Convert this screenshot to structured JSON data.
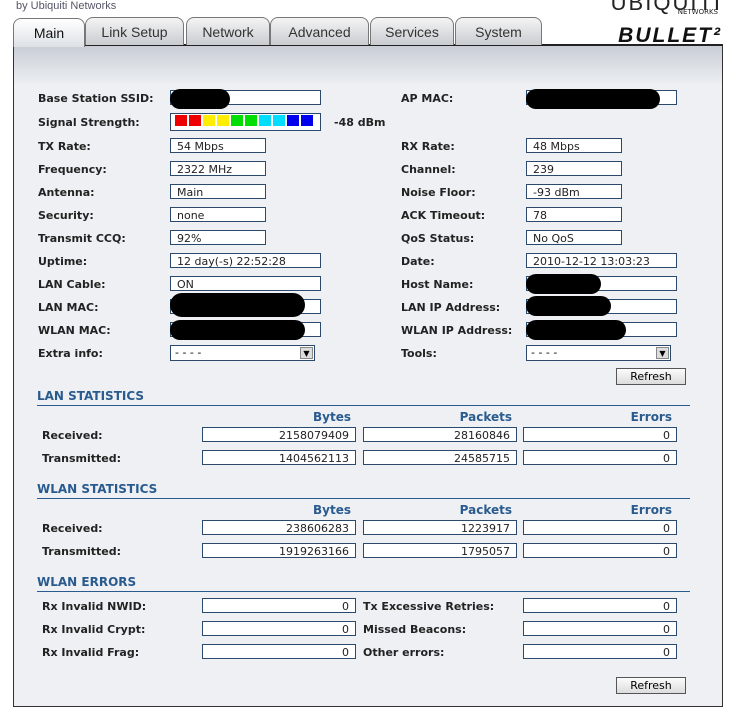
{
  "header": {
    "brand_sub": "by Ubiquiti Networks",
    "logo": "UBIQUITI",
    "logo_sub": "NETWORKS",
    "product": "BULLET²"
  },
  "tabs": [
    "Main",
    "Link Setup",
    "Network",
    "Advanced",
    "Services",
    "System"
  ],
  "left": {
    "ssid_label": "Base Station SSID:",
    "signal_label": "Signal Strength:",
    "signal_value": "-48 dBm",
    "signal_colors": [
      "#ee0000",
      "#ee0000",
      "#ffee00",
      "#ffee00",
      "#00dd00",
      "#00dd00",
      "#00ddff",
      "#00ddff",
      "#0000ee",
      "#0000ee"
    ],
    "rows": [
      {
        "label": "TX Rate:",
        "value": "54 Mbps"
      },
      {
        "label": "Frequency:",
        "value": "2322 MHz"
      },
      {
        "label": "Antenna:",
        "value": "Main"
      },
      {
        "label": "Security:",
        "value": "none"
      },
      {
        "label": "Transmit CCQ:",
        "value": "92%"
      },
      {
        "label": "Uptime:",
        "value": "12 day(-s) 22:52:28"
      },
      {
        "label": "LAN Cable:",
        "value": "ON"
      }
    ],
    "lan_mac_label": "LAN MAC:",
    "wlan_mac_label": "WLAN MAC:",
    "extra_label": "Extra info:",
    "extra_value": "- - - -"
  },
  "right": {
    "ap_mac_label": "AP MAC:",
    "rows": [
      {
        "label": "RX Rate:",
        "value": "48 Mbps"
      },
      {
        "label": "Channel:",
        "value": "239"
      },
      {
        "label": "Noise Floor:",
        "value": "-93 dBm"
      },
      {
        "label": "ACK Timeout:",
        "value": "78"
      },
      {
        "label": "QoS Status:",
        "value": "No QoS"
      },
      {
        "label": "Date:",
        "value": "2010-12-12 13:03:23"
      }
    ],
    "host_label": "Host Name:",
    "lan_ip_label": "LAN IP Address:",
    "wlan_ip_label": "WLAN IP Address:",
    "tools_label": "Tools:",
    "tools_value": "- - - -"
  },
  "refresh": "Refresh",
  "lan_stats": {
    "title": "LAN STATISTICS",
    "cols": [
      "Bytes",
      "Packets",
      "Errors"
    ],
    "rows": [
      {
        "label": "Received:",
        "bytes": "2158079409",
        "packets": "28160846",
        "errors": "0"
      },
      {
        "label": "Transmitted:",
        "bytes": "1404562113",
        "packets": "24585715",
        "errors": "0"
      }
    ]
  },
  "wlan_stats": {
    "title": "WLAN STATISTICS",
    "cols": [
      "Bytes",
      "Packets",
      "Errors"
    ],
    "rows": [
      {
        "label": "Received:",
        "bytes": "238606283",
        "packets": "1223917",
        "errors": "0"
      },
      {
        "label": "Transmitted:",
        "bytes": "1919263166",
        "packets": "1795057",
        "errors": "0"
      }
    ]
  },
  "wlan_errors": {
    "title": "WLAN ERRORS",
    "left": [
      {
        "label": "Rx Invalid NWID:",
        "value": "0"
      },
      {
        "label": "Rx Invalid Crypt:",
        "value": "0"
      },
      {
        "label": "Rx Invalid Frag:",
        "value": "0"
      }
    ],
    "right": [
      {
        "label": "Tx Excessive Retries:",
        "value": "0"
      },
      {
        "label": "Missed Beacons:",
        "value": "0"
      },
      {
        "label": "Other errors:",
        "value": "0"
      }
    ]
  }
}
